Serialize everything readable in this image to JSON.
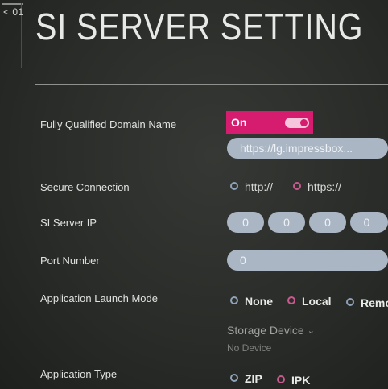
{
  "header": {
    "back_label": "< 01",
    "title": "SI SERVER SETTING"
  },
  "fqdn": {
    "label": "Fully Qualified Domain Name",
    "toggle_label": "On",
    "toggle_state": true,
    "url_value": "https://lg.impressbox..."
  },
  "secure": {
    "label": "Secure Connection",
    "options": [
      "http://",
      "https://"
    ]
  },
  "server_ip": {
    "label": "SI Server IP",
    "octets": [
      "0",
      "0",
      "0",
      "0"
    ]
  },
  "port": {
    "label": "Port Number",
    "value": "0"
  },
  "launch_mode": {
    "label": "Application Launch Mode",
    "options": [
      "None",
      "Local",
      "Remo"
    ]
  },
  "storage": {
    "title": "Storage Device",
    "value": "No Device"
  },
  "app_type": {
    "label": "Application Type",
    "options": [
      "ZIP",
      "IPK"
    ]
  },
  "colors": {
    "accent_pink": "#d61c6e",
    "field_blue": "#aab6c4",
    "background": "#2a2c29"
  }
}
